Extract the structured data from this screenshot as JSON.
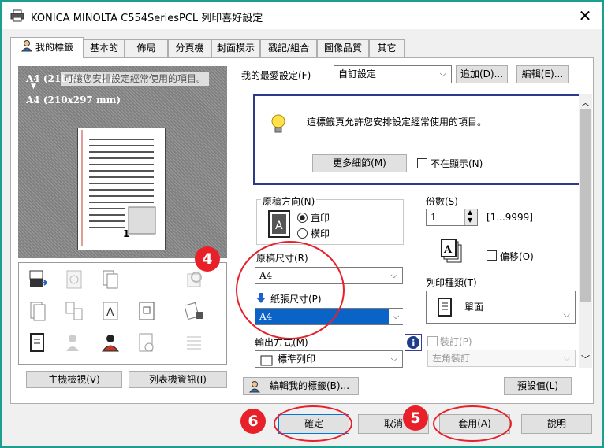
{
  "window": {
    "title": "KONICA MINOLTA C554SeriesPCL 列印喜好設定",
    "close_symbol": "✕"
  },
  "tabs": [
    {
      "label": "我的標籤",
      "active": true
    },
    {
      "label": "基本的"
    },
    {
      "label": "佈局"
    },
    {
      "label": "分頁機"
    },
    {
      "label": "封面模示"
    },
    {
      "label": "戳記/組合"
    },
    {
      "label": "圖像品質"
    },
    {
      "label": "其它"
    }
  ],
  "preview": {
    "line1": "A4 (210x297 mm)",
    "line2": "A4 (210x297 mm)",
    "tooltip": "可讓您安排設定經常使用的項目。",
    "page_number": "1"
  },
  "left_buttons": {
    "printer_view": "主機檢視(V)",
    "printer_info": "列表機資訊(I)"
  },
  "favorites": {
    "label": "我的最愛設定(F)",
    "value": "自訂設定",
    "add": "追加(D)...",
    "edit": "編輯(E)..."
  },
  "info_box": {
    "message": "這標籤頁允許您安排設定經常使用的項目。",
    "more_details": "更多細節(M)",
    "dont_show": "不在顯示(N)"
  },
  "orientation": {
    "group_label": "原稿方向(N)",
    "portrait": "直印",
    "landscape": "橫印",
    "selected": "直印"
  },
  "original_size": {
    "label": "原稿尺寸(R)",
    "value": "A4"
  },
  "paper_size": {
    "label": "紙張尺寸(P)",
    "value": "A4"
  },
  "output_method": {
    "label": "輸出方式(M)",
    "value": "標準列印"
  },
  "copies": {
    "label": "份數(S)",
    "value": "1",
    "range": "[1...9999]"
  },
  "offset": {
    "label": "偏移(O)"
  },
  "print_type": {
    "label": "列印種類(T)",
    "value": "單面"
  },
  "binding": {
    "label": "裝訂(P)",
    "value": "左角裝訂"
  },
  "bottom_left": {
    "edit_tab": "編輯我的標籤(B)..."
  },
  "defaults_button": "預設值(L)",
  "footer": {
    "ok": "確定",
    "cancel": "取消",
    "apply": "套用(A)",
    "help": "說明"
  },
  "annotations": [
    {
      "number": "4"
    },
    {
      "number": "5"
    },
    {
      "number": "6"
    }
  ],
  "colors": {
    "accent": "#e8202a",
    "selection": "#0a64c8",
    "info_border": "#2b3a8a",
    "page_bg": "#1e9e8e"
  },
  "icons": {
    "printer": "printer-icon",
    "bulb": "lightbulb-icon",
    "info": "info-icon",
    "paper_arrow": "arrow-down-icon"
  }
}
